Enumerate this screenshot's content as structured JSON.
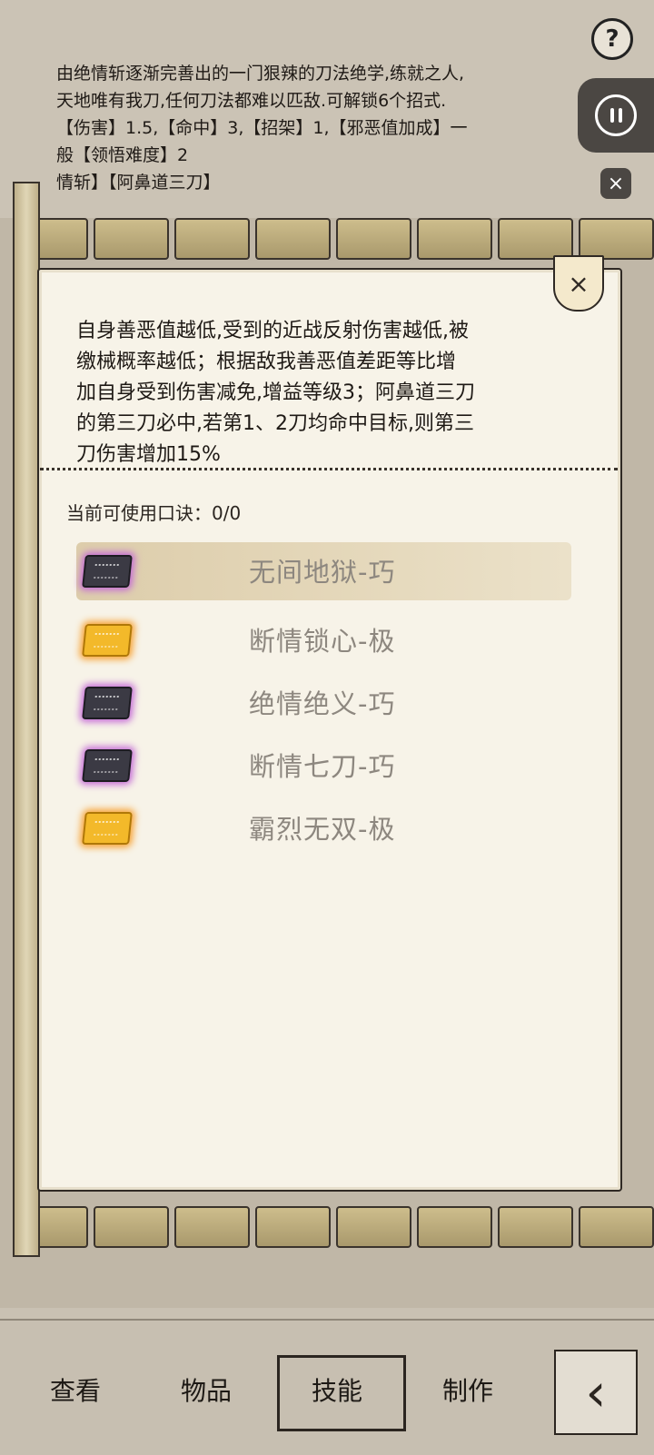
{
  "skill_info": {
    "lines": [
      "由绝情斩逐渐完善出的一门狠辣的刀法绝学,练就之人,",
      "天地唯有我刀,任何刀法都难以匹敌.可解锁6个招式.",
      "【伤害】1.5,【命中】3,【招架】1,【邪恶值加成】一",
      "般【领悟难度】2",
      "          情斩】【阿鼻道三刀】"
    ]
  },
  "controls": {
    "help_icon": "question-icon",
    "help_label": "?",
    "pause_icon": "pause-icon",
    "close_icon": "close-icon",
    "close_label": "×"
  },
  "panel": {
    "close_label": "×",
    "description_lines": [
      "自身善恶值越低,受到的近战反射伤害越低,被",
      "缴械概率越低；根据敌我善恶值差距等比增",
      "加自身受到伤害减免,增益等级3；阿鼻道三刀",
      "的第三刀必中,若第1、2刀均命中目标,则第三",
      "刀伤害增加15%"
    ],
    "count_label": "当前可使用口诀：0/0",
    "skills": [
      {
        "name": "无间地狱-巧",
        "book": "purple",
        "selected": true
      },
      {
        "name": "断情锁心-极",
        "book": "gold",
        "selected": false
      },
      {
        "name": "绝情绝义-巧",
        "book": "purple",
        "selected": false
      },
      {
        "name": "断情七刀-巧",
        "book": "purple",
        "selected": false
      },
      {
        "name": "霸烈无双-极",
        "book": "gold",
        "selected": false
      }
    ]
  },
  "tabs": {
    "view": "查看",
    "items": "物品",
    "skills": "技能",
    "craft": "制作",
    "selected": "技能",
    "back_icon": "back-arrow-icon",
    "back_label": "‹"
  },
  "colors": {
    "purple_glow": "#c46ad6",
    "gold_book": "#f3b92a",
    "panel_bg": "#f7f3e8"
  }
}
